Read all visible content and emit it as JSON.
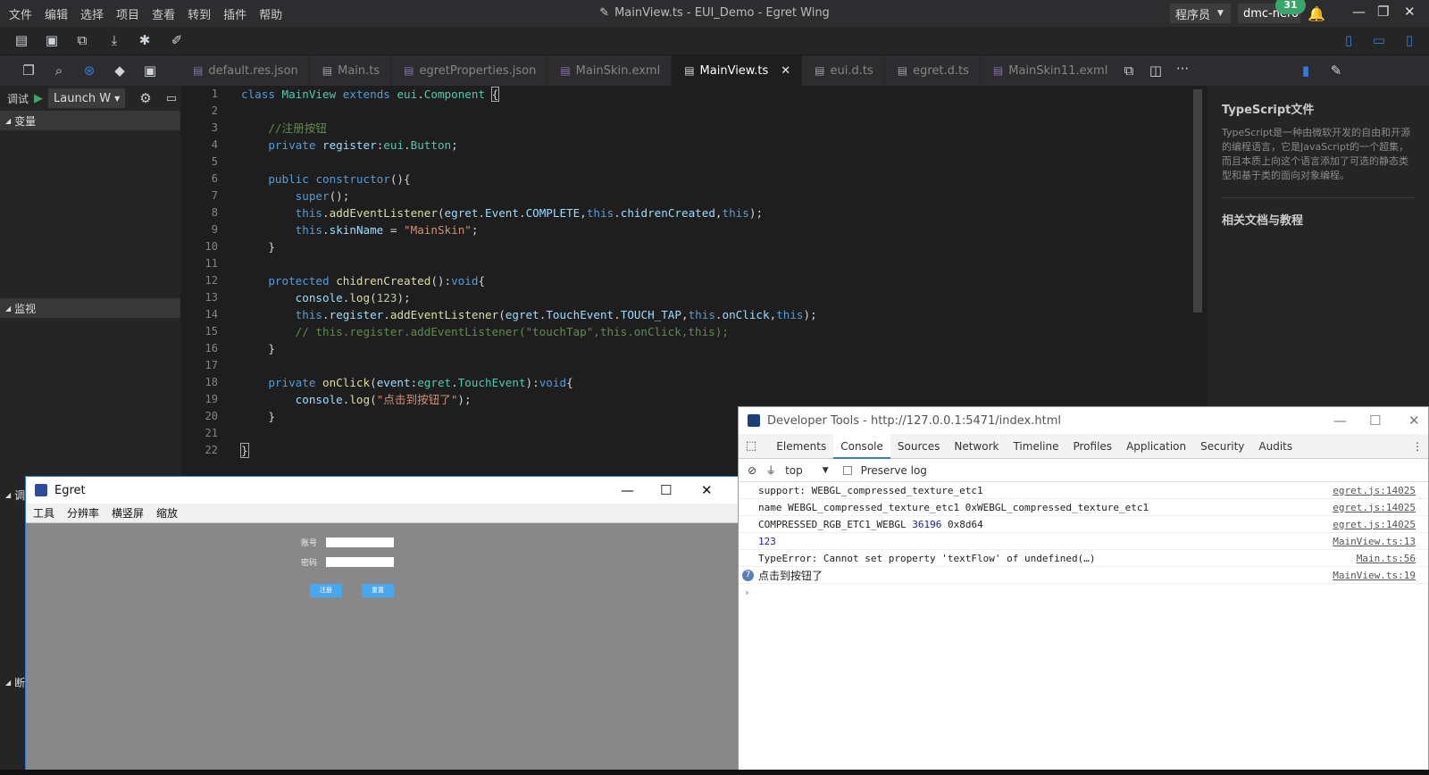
{
  "menubar": {
    "items": [
      "文件",
      "编辑",
      "选择",
      "项目",
      "查看",
      "转到",
      "插件",
      "帮助"
    ],
    "title": "MainView.ts - EUI_Demo - Egret Wing",
    "role": "程序员",
    "user": "dmc-nero",
    "notifications": "31"
  },
  "toolbar_icons": [
    "new-project-icon",
    "save-icon",
    "save-all-icon",
    "publish-icon",
    "debug-icon",
    "brush-icon"
  ],
  "tabs": [
    {
      "label": "default.res.json",
      "active": false
    },
    {
      "label": "Main.ts",
      "active": false
    },
    {
      "label": "egretProperties.json",
      "active": false
    },
    {
      "label": "MainSkin.exml",
      "active": false
    },
    {
      "label": "MainView.ts",
      "active": true
    },
    {
      "label": "eui.d.ts",
      "active": false
    },
    {
      "label": "egret.d.ts",
      "active": false
    },
    {
      "label": "MainSkin11.exml",
      "active": false
    }
  ],
  "debug": {
    "label": "调试",
    "launch": "Launch W",
    "sections": {
      "variables": "变量",
      "watch": "监视",
      "callstack": "调",
      "breakpoints": "断"
    }
  },
  "editor": {
    "line_numbers": [
      "1",
      "2",
      "3",
      "4",
      "5",
      "6",
      "7",
      "8",
      "9",
      "10",
      "11",
      "12",
      "13",
      "14",
      "15",
      "16",
      "17",
      "18",
      "19",
      "20",
      "21",
      "22"
    ]
  },
  "right_panel": {
    "title": "TypeScript文件",
    "desc": "TypeScript是一种由微软开发的自由和开源的编程语言，它是JavaScript的一个超集，而且本质上向这个语言添加了可选的静态类型和基于类的面向对象编程。",
    "docs_title": "相关文档与教程"
  },
  "egret_window": {
    "title": "Egret",
    "menu": [
      "工具",
      "分辨率",
      "横竖屏",
      "缩放"
    ],
    "account_label": "账号",
    "password_label": "密码",
    "login_button": "注册",
    "reset_button": "重置"
  },
  "devtools": {
    "title": "Developer Tools - http://127.0.0.1:5471/index.html",
    "tabs": [
      "Elements",
      "Console",
      "Sources",
      "Network",
      "Timeline",
      "Profiles",
      "Application",
      "Security",
      "Audits"
    ],
    "active_tab": "Console",
    "context": "top",
    "preserve_log": "Preserve log",
    "logs": [
      {
        "msg": "support: WEBGL_compressed_texture_etc1",
        "src": "egret.js:14025"
      },
      {
        "msg": "name WEBGL_compressed_texture_etc1 0xWEBGL_compressed_texture_etc1",
        "src": "egret.js:14025"
      },
      {
        "msg": "COMPRESSED_RGB_ETC1_WEBGL",
        "num": "36196",
        "msg2": " 0x8d64",
        "src": "egret.js:14025"
      },
      {
        "msg": "123",
        "src": "MainView.ts:13",
        "blue": true
      },
      {
        "msg": "TypeError: Cannot set property 'textFlow' of undefined(…)",
        "src": "Main.ts:56"
      },
      {
        "msg": "点击到按钮了",
        "src": "MainView.ts:19",
        "count": "7"
      }
    ]
  },
  "colors": {
    "accent": "#3879d9",
    "editor_bg": "#1e1e1e",
    "keyword": "#569cd6",
    "class": "#4ec9b0",
    "string": "#ce9178",
    "comment": "#608b4e"
  }
}
